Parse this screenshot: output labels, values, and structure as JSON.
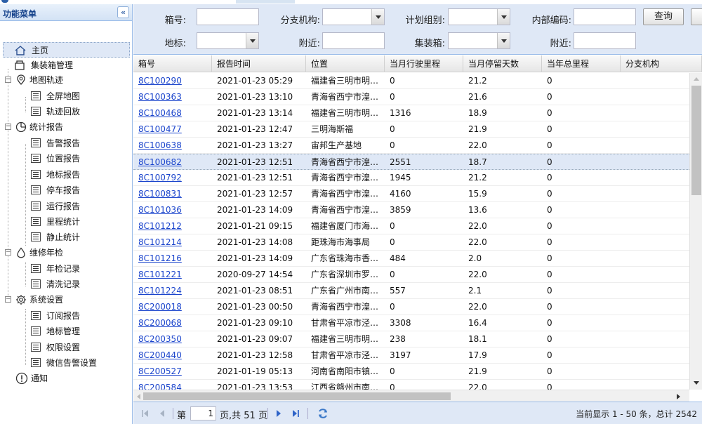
{
  "sidebar": {
    "title": "功能菜单",
    "collapse_glyph": "«",
    "items": [
      {
        "label": "主页"
      },
      {
        "label": "集装箱管理"
      },
      {
        "label": "地图轨迹"
      },
      {
        "label": "全屏地图"
      },
      {
        "label": "轨迹回放"
      },
      {
        "label": "统计报告"
      },
      {
        "label": "告警报告"
      },
      {
        "label": "位置报告"
      },
      {
        "label": "地标报告"
      },
      {
        "label": "停车报告"
      },
      {
        "label": "运行报告"
      },
      {
        "label": "里程统计"
      },
      {
        "label": "静止统计"
      },
      {
        "label": "维修年检"
      },
      {
        "label": "年检记录"
      },
      {
        "label": "清洗记录"
      },
      {
        "label": "系统设置"
      },
      {
        "label": "订阅报告"
      },
      {
        "label": "地标管理"
      },
      {
        "label": "权限设置"
      },
      {
        "label": "微信告警设置"
      },
      {
        "label": "通知"
      }
    ]
  },
  "filters": {
    "box_no": {
      "label": "箱号:",
      "value": ""
    },
    "branch": {
      "label": "分支机构:",
      "value": ""
    },
    "plan_group": {
      "label": "计划组别:",
      "value": ""
    },
    "internal_code": {
      "label": "内部编码:",
      "value": ""
    },
    "landmark": {
      "label": "地标:",
      "value": ""
    },
    "nearby1": {
      "label": "附近:",
      "value": ""
    },
    "container": {
      "label": "集装箱:",
      "value": ""
    },
    "nearby2": {
      "label": "附近:",
      "value": ""
    },
    "query_button": "查询"
  },
  "grid": {
    "columns": [
      "箱号",
      "报告时间",
      "位置",
      "当月行驶里程",
      "当月停留天数",
      "当年总里程",
      "分支机构"
    ],
    "selected_row": 5,
    "rows": [
      [
        "8C100290",
        "2021-01-23 05:29",
        "福建省三明市明溪县",
        "0",
        "21.2",
        "0",
        ""
      ],
      [
        "8C100363",
        "2021-01-23 13:10",
        "青海省西宁市湟中县",
        "0",
        "21.6",
        "0",
        ""
      ],
      [
        "8C100468",
        "2021-01-23 13:14",
        "福建省三明市明溪县",
        "1316",
        "18.9",
        "0",
        ""
      ],
      [
        "8C100477",
        "2021-01-23 12:47",
        "三明海斯福",
        "0",
        "21.9",
        "0",
        ""
      ],
      [
        "8C100638",
        "2021-01-23 13:27",
        "宙邦生产基地",
        "0",
        "22.0",
        "0",
        ""
      ],
      [
        "8C100682",
        "2021-01-23 12:51",
        "青海省西宁市湟中县",
        "2551",
        "18.7",
        "0",
        ""
      ],
      [
        "8C100792",
        "2021-01-23 12:51",
        "青海省西宁市湟中县",
        "1945",
        "21.2",
        "0",
        ""
      ],
      [
        "8C100831",
        "2021-01-23 12:57",
        "青海省西宁市湟中县",
        "4160",
        "15.9",
        "0",
        ""
      ],
      [
        "8C101036",
        "2021-01-23 14:09",
        "青海省西宁市湟中县",
        "3859",
        "13.6",
        "0",
        ""
      ],
      [
        "8C101212",
        "2021-01-21 09:15",
        "福建省厦门市海沧区",
        "0",
        "22.0",
        "0",
        ""
      ],
      [
        "8C101214",
        "2021-01-23 14:08",
        "距珠海市海事局",
        "0",
        "22.0",
        "0",
        ""
      ],
      [
        "8C101216",
        "2021-01-23 14:09",
        "广东省珠海市香洲区",
        "484",
        "2.0",
        "0",
        ""
      ],
      [
        "8C101221",
        "2020-09-27 14:54",
        "广东省深圳市罗湖区",
        "0",
        "22.0",
        "0",
        ""
      ],
      [
        "8C101224",
        "2021-01-23 08:51",
        "广东省广州市南沙区",
        "557",
        "2.1",
        "0",
        ""
      ],
      [
        "8C200018",
        "2021-01-23 00:50",
        "青海省西宁市湟中县",
        "0",
        "22.0",
        "0",
        ""
      ],
      [
        "8C200068",
        "2021-01-23 09:10",
        "甘肃省平凉市泾川县",
        "3308",
        "16.4",
        "0",
        ""
      ],
      [
        "8C200350",
        "2021-01-23 09:07",
        "福建省三明市明溪县",
        "238",
        "18.1",
        "0",
        ""
      ],
      [
        "8C200440",
        "2021-01-23 12:58",
        "甘肃省平凉市泾川县",
        "3197",
        "17.9",
        "0",
        ""
      ],
      [
        "8C200527",
        "2021-01-19 05:13",
        "河南省南阳市镇平县",
        "0",
        "21.9",
        "0",
        ""
      ],
      [
        "8C200584",
        "2021-01-23 13:53",
        "江西省赣州市南康区",
        "0",
        "22.0",
        "0",
        ""
      ]
    ]
  },
  "pager": {
    "page_label": "第",
    "page_value": "1",
    "page_total": "页,共 51 页",
    "summary": "当前显示 1 - 50 条，总计 2542"
  }
}
